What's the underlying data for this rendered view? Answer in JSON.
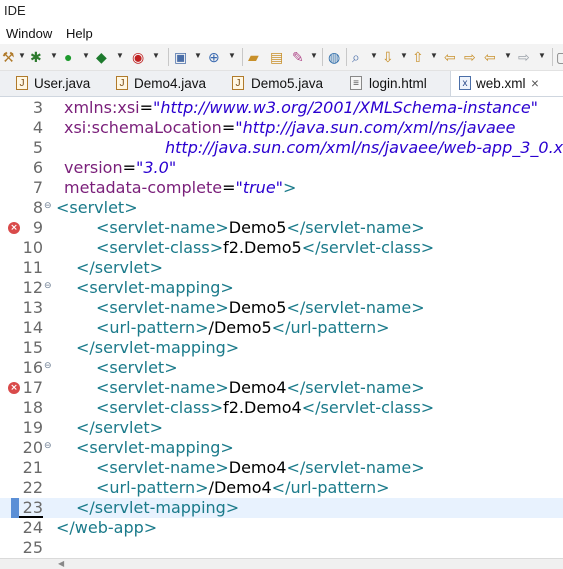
{
  "app": {
    "title": "IDE"
  },
  "menu": {
    "items": [
      "Window",
      "Help"
    ]
  },
  "tabs": [
    {
      "label": "User.java",
      "icon": "java-file-icon",
      "active": false
    },
    {
      "label": "Demo4.java",
      "icon": "java-file-icon",
      "active": false
    },
    {
      "label": "Demo5.java",
      "icon": "java-file-icon",
      "active": false
    },
    {
      "label": "login.html",
      "icon": "html-file-icon",
      "active": false
    },
    {
      "label": "web.xml",
      "icon": "xml-file-icon",
      "active": true,
      "close": "×"
    }
  ],
  "editor": {
    "current_line": 23,
    "lines": [
      {
        "num": "3",
        "segments": [
          {
            "cls": "attr",
            "t": "xmlns:xsi"
          },
          {
            "cls": "txt",
            "t": "="
          },
          {
            "cls": "str",
            "t": "\"http://www.w3.org/2001/XMLSchema-instance\""
          }
        ]
      },
      {
        "num": "4",
        "segments": [
          {
            "cls": "attr",
            "t": "xsi:schemaLocation"
          },
          {
            "cls": "txt",
            "t": "="
          },
          {
            "cls": "str",
            "t": "\"http://java.sun.com/xml/ns/javaee"
          }
        ]
      },
      {
        "num": "5",
        "segments": [
          {
            "cls": "str",
            "t": "http://java.sun.com/xml/ns/javaee/web-app_3_0.x"
          }
        ]
      },
      {
        "num": "6",
        "segments": [
          {
            "cls": "attr",
            "t": "version"
          },
          {
            "cls": "txt",
            "t": "="
          },
          {
            "cls": "str",
            "t": "\"3.0\""
          }
        ]
      },
      {
        "num": "7",
        "segments": [
          {
            "cls": "attr",
            "t": "metadata-complete"
          },
          {
            "cls": "txt",
            "t": "="
          },
          {
            "cls": "str",
            "t": "\"true\""
          },
          {
            "cls": "tag",
            "t": ">"
          }
        ]
      },
      {
        "num": "8",
        "fold": true,
        "segments": [
          {
            "cls": "tag",
            "t": "<servlet>"
          }
        ]
      },
      {
        "num": "9",
        "error": true,
        "segments": [
          {
            "cls": "tag",
            "t": "<servlet-name>"
          },
          {
            "cls": "txt",
            "t": "Demo5"
          },
          {
            "cls": "tag",
            "t": "</servlet-name>"
          }
        ]
      },
      {
        "num": "10",
        "segments": [
          {
            "cls": "tag",
            "t": "<servlet-class>"
          },
          {
            "cls": "txt",
            "t": "f2.Demo5"
          },
          {
            "cls": "tag",
            "t": "</servlet-class>"
          }
        ]
      },
      {
        "num": "11",
        "segments": [
          {
            "cls": "tag",
            "t": "</servlet>"
          }
        ]
      },
      {
        "num": "12",
        "fold": true,
        "segments": [
          {
            "cls": "tag",
            "t": "<servlet-mapping>"
          }
        ]
      },
      {
        "num": "13",
        "segments": [
          {
            "cls": "tag",
            "t": "<servlet-name>"
          },
          {
            "cls": "txt",
            "t": "Demo5"
          },
          {
            "cls": "tag",
            "t": "</servlet-name>"
          }
        ]
      },
      {
        "num": "14",
        "segments": [
          {
            "cls": "tag",
            "t": "<url-pattern>"
          },
          {
            "cls": "txt",
            "t": "/Demo5"
          },
          {
            "cls": "tag",
            "t": "</url-pattern>"
          }
        ]
      },
      {
        "num": "15",
        "segments": [
          {
            "cls": "tag",
            "t": "</servlet-mapping>"
          }
        ]
      },
      {
        "num": "16",
        "fold": true,
        "segments": [
          {
            "cls": "tag",
            "t": "<servlet>"
          }
        ]
      },
      {
        "num": "17",
        "error": true,
        "segments": [
          {
            "cls": "tag",
            "t": "<servlet-name>"
          },
          {
            "cls": "txt",
            "t": "Demo4"
          },
          {
            "cls": "tag",
            "t": "</servlet-name>"
          }
        ]
      },
      {
        "num": "18",
        "segments": [
          {
            "cls": "tag",
            "t": "<servlet-class>"
          },
          {
            "cls": "txt",
            "t": "f2.Demo4"
          },
          {
            "cls": "tag",
            "t": "</servlet-class>"
          }
        ]
      },
      {
        "num": "19",
        "segments": [
          {
            "cls": "tag",
            "t": "</servlet>"
          }
        ]
      },
      {
        "num": "20",
        "fold": true,
        "segments": [
          {
            "cls": "tag",
            "t": "<servlet-mapping>"
          }
        ]
      },
      {
        "num": "21",
        "segments": [
          {
            "cls": "tag",
            "t": "<servlet-name>"
          },
          {
            "cls": "txt",
            "t": "Demo4"
          },
          {
            "cls": "tag",
            "t": "</servlet-name>"
          }
        ]
      },
      {
        "num": "22",
        "segments": [
          {
            "cls": "tag",
            "t": "<url-pattern>"
          },
          {
            "cls": "txt",
            "t": "/Demo4"
          },
          {
            "cls": "tag",
            "t": "</url-pattern>"
          }
        ]
      },
      {
        "num": "23",
        "segments": [
          {
            "cls": "tag",
            "t": "</servlet-mapping>"
          }
        ]
      },
      {
        "num": "24",
        "segments": [
          {
            "cls": "tag",
            "t": "</web-app>"
          }
        ]
      },
      {
        "num": "25",
        "segments": []
      }
    ]
  },
  "colors": {
    "tag": "#1a7a8a",
    "attr": "#7a1f7a",
    "string": "#2a00d0",
    "current_line": "#e8f2fe",
    "error": "#d94a4a"
  }
}
